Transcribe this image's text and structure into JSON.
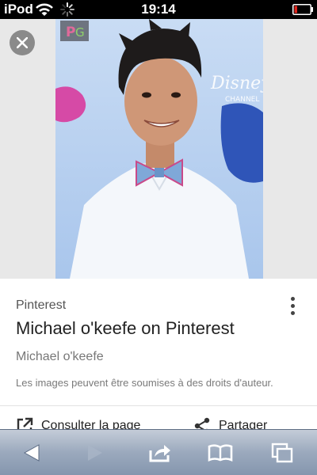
{
  "status_bar": {
    "carrier": "iPod",
    "time": "19:14"
  },
  "viewer": {
    "site_badge_text": "PG",
    "watermark_text": "Disney Channel"
  },
  "card": {
    "source": "Pinterest",
    "title": "Michael o'keefe on Pinterest",
    "author": "Michael o'keefe",
    "notice": "Les images peuvent être soumises à des droits d'auteur.",
    "actions": {
      "open_label": "Consulter la page",
      "share_label": "Partager"
    }
  },
  "toolbar": {
    "back_enabled": true,
    "forward_enabled": false
  },
  "colors": {
    "toolbar_top": "#c4ccd8",
    "toolbar_bottom": "#8596ae",
    "card_background": "#ffffff",
    "photo_background": "#b8d2f0"
  }
}
